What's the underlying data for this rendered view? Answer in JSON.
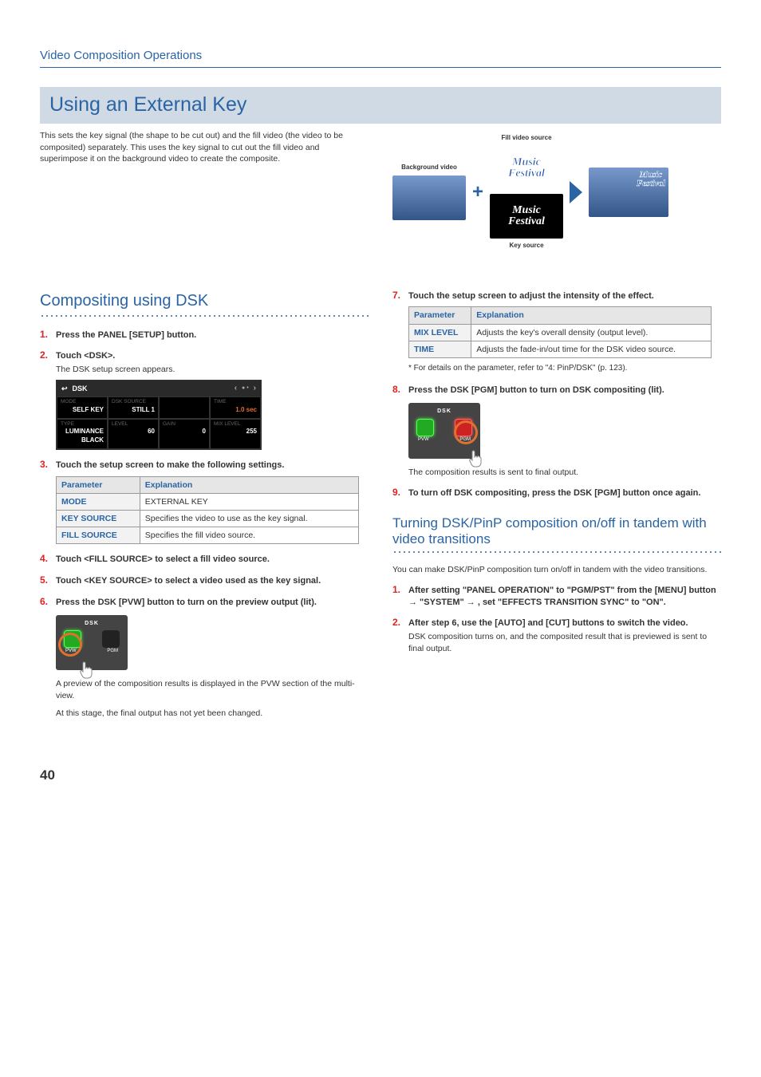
{
  "breadcrumb": "Video Composition Operations",
  "main_heading": "Using an External Key",
  "intro": "This sets the key signal (the shape to be cut out) and the fill video (the video to be composited) separately. This uses the key signal to cut out the fill video and superimpose it on the background video to create the composite.",
  "diagram": {
    "bg_label": "Background video",
    "fill_label": "Fill video source",
    "key_label": "Key source",
    "music": "Music",
    "festival": "Festival"
  },
  "sub1": "Compositing using DSK",
  "steps_left": {
    "s1": {
      "n": "1.",
      "t": "Press the PANEL [SETUP] button."
    },
    "s2": {
      "n": "2.",
      "t": "Touch <DSK>.",
      "sub": "The DSK setup screen appears."
    },
    "s3": {
      "n": "3.",
      "t": "Touch the setup screen to make the following settings."
    },
    "s4": {
      "n": "4.",
      "t": "Touch <FILL SOURCE> to select a fill video source."
    },
    "s5": {
      "n": "5.",
      "t": "Touch <KEY SOURCE> to select a video used as the key signal."
    },
    "s6": {
      "n": "6.",
      "t": "Press the DSK [PVW] button to turn on the preview output (lit).",
      "sub1": "A preview of the composition results is displayed in the PVW section of the multi-view.",
      "sub2": "At this stage, the final output has not yet been changed."
    }
  },
  "dsk_screen": {
    "title": "DSK",
    "mode_l": "MODE",
    "mode_v": "SELF KEY",
    "src_l": "DSK SOURCE",
    "src_v": "STILL 1",
    "time_l": "TIME",
    "time_v": "1.0 sec",
    "type_l": "TYPE",
    "type_v": "LUMINANCE BLACK",
    "lvl_l": "LEVEL",
    "lvl_v": "60",
    "gain_l": "GAIN",
    "gain_v": "0",
    "mix_l": "MIX LEVEL",
    "mix_v": "255"
  },
  "table1": {
    "h1": "Parameter",
    "h2": "Explanation",
    "r1p": "MODE",
    "r1e": "EXTERNAL KEY",
    "r2p": "KEY SOURCE",
    "r2e": "Specifies the video to use as the key signal.",
    "r3p": "FILL SOURCE",
    "r3e": "Specifies the fill video source."
  },
  "panel": {
    "title": "DSK",
    "pvw": "PVW",
    "pgm": "PGM"
  },
  "steps_right": {
    "s7": {
      "n": "7.",
      "t": "Touch the setup screen to adjust the intensity of the effect."
    },
    "s8": {
      "n": "8.",
      "t": "Press the DSK [PGM] button to turn on DSK compositing (lit).",
      "sub": "The composition results is sent to final output."
    },
    "s9": {
      "n": "9.",
      "t": "To turn off DSK compositing, press the DSK [PGM] button once again."
    }
  },
  "table2": {
    "h1": "Parameter",
    "h2": "Explanation",
    "r1p": "MIX LEVEL",
    "r1e": "Adjusts the key's overall density (output level).",
    "r2p": "TIME",
    "r2e": "Adjusts the fade-in/out time for the DSK video source."
  },
  "footnote1": "* For details on the parameter, refer to \"4: PinP/DSK\" (p. 123).",
  "sub2": "Turning DSK/PinP composition on/off in tandem with video transitions",
  "tandem_intro": "You can make DSK/PinP composition turn on/off in tandem with the video transitions.",
  "tandem": {
    "s1": {
      "n": "1.",
      "t": "After setting \"PANEL OPERATION\" to \"PGM/PST\" from the [MENU] button → \"SYSTEM\" → , set \"EFFECTS TRANSITION SYNC\" to \"ON\"."
    },
    "s2": {
      "n": "2.",
      "t": "After step 6, use the [AUTO] and [CUT] buttons to switch the video.",
      "sub": "DSK composition turns on, and the composited result that is previewed is sent to final output."
    }
  },
  "page": "40"
}
